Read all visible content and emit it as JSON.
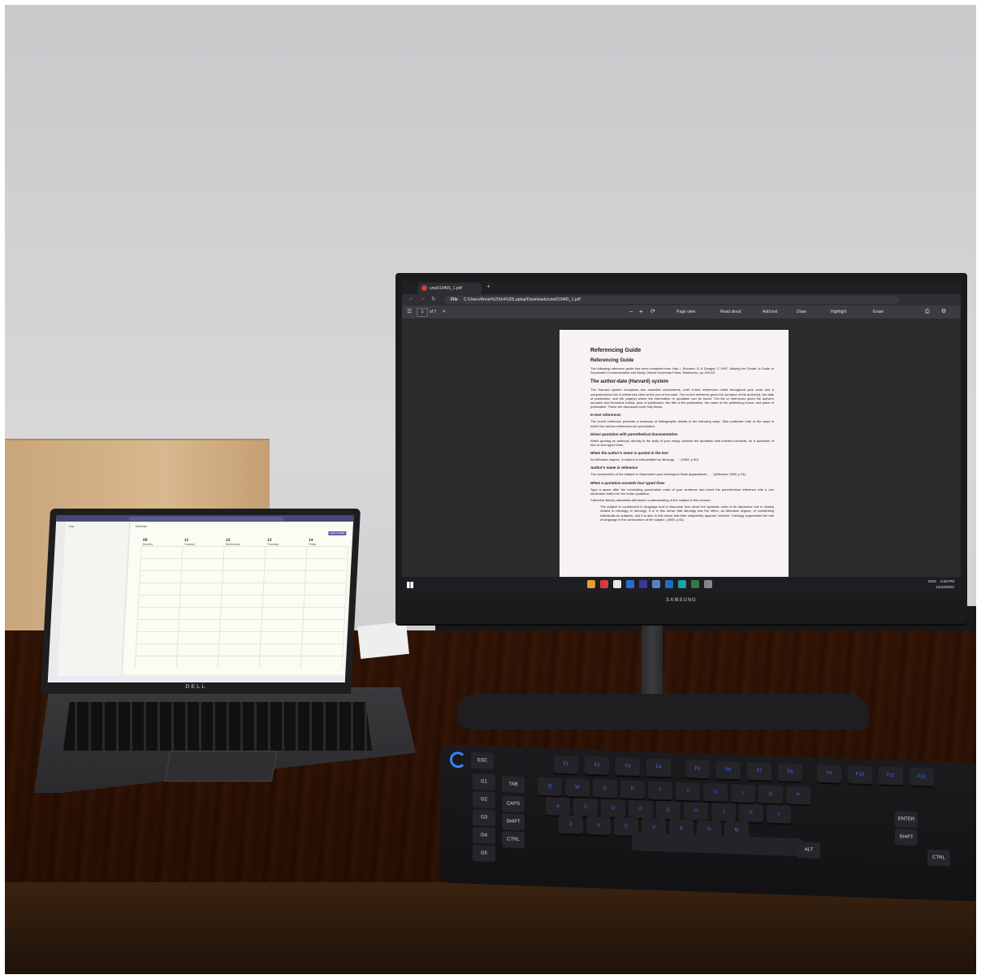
{
  "monitor": {
    "tab_title": "unw019465_1.pdf",
    "address_scheme": "File",
    "address_path": "C:/Users/Annie%20Uni%20Laptop/Downloads/unw019465_1.pdf",
    "page_number": "1",
    "page_count": "of 7",
    "toolbar": {
      "page_view": "Page view",
      "read_aloud": "Read aloud",
      "add_text": "Add text",
      "draw": "Draw",
      "highlight": "Highlight",
      "erase": "Erase"
    },
    "brand": "SAMSUNG",
    "tray_time": "5:46 PM",
    "tray_date": "12/10/2022",
    "tray_lang": "ENG"
  },
  "document": {
    "title": "Referencing Guide",
    "subtitle": "Referencing Guide",
    "intro": "The following reference guide has been extracted from Hay, I, Bochner, D & Dungey, C 1997, Making the Grade: A Guide to Successful Communication and Study, Oxford University Press, Melbourne, pp 139-45.",
    "section1_title": "The author-date (Harvard) system",
    "section1_body": "The Harvard system comprises two essential components, brief in-text references noted throughout your work and a comprehensive list of references cited at the end of the work. The in-text reference gives the surname of the author(s), the date of publication, and the page(s) where the information or quotation can be found. The list of references gives the author's surname and forename initials, year of publication, the title of the publication, the name of the publishing house, and place of publication. These are discussed more fully below.",
    "section2_title": "In-text references",
    "section2_body": "The in-text reference presents a summary of bibliographic details in the following ways. Take particular note of the ways in which the various references are punctuated.",
    "sub1_title": "Direct quotation with parenthetical documentation",
    "sub1_body": "When quoting an author(s) directly in the body of your essay, enclose the quotation with inverted commas, for a quotation of four or less typed lines.",
    "sub2_title": "When the author's name is quoted in the text",
    "sub2_body": "As Althusser argues, 'a subject is interpellated by ideology . . .' (1969, p 50).",
    "sub3_title": "Author's name in reference",
    "sub3_body": "The construction of the subject is 'dependent upon Ideological State Apparatuses . . .' (Althusser 1969, p 51).",
    "sub4_title": "When a quotation exceeds four typed lines",
    "sub4_body": "Type a space after the concluding punctuation mark of your sentence and insert the parenthetical reference with a one centimetre indent for the entire quotation.",
    "sub4_body2": "Catherine Belsey articulates Althusser's understanding of the subject in this manner:",
    "blockquote": "The subject is constructed in language and in discourse and, since the symbolic order is its discursive role is closely related to ideology, in ideology. It is in this sense that ideology has the effect, as Althusser argues, of constituting individuals as subjects, and it is also in this sense that their subjectivity appears 'obvious'. Ideology suppresses the role of language in the construction of the subject. (1980, p 61)"
  },
  "laptop": {
    "brand": "DELL",
    "app_title": "Calendar",
    "left_title": "Chat",
    "days": [
      {
        "num": "09",
        "name": "Monday"
      },
      {
        "num": "11",
        "name": "Tuesday"
      },
      {
        "num": "12",
        "name": "Wednesday"
      },
      {
        "num": "13",
        "name": "Thursday"
      },
      {
        "num": "14",
        "name": "Friday"
      }
    ],
    "new_meeting": "New meeting"
  },
  "keyboard": {
    "g_keys": [
      "G1",
      "G2",
      "G3",
      "G4",
      "G5"
    ],
    "row_mod": [
      "ESC",
      "TAB",
      "CAPS",
      "SHIFT",
      "CTRL"
    ],
    "letters_row1": [
      "Q",
      "W",
      "E",
      "R",
      "T",
      "Y",
      "U",
      "I",
      "O",
      "P"
    ],
    "letters_row2": [
      "A",
      "S",
      "D",
      "F",
      "G",
      "H",
      "J",
      "K",
      "L"
    ],
    "letters_row3": [
      "Z",
      "X",
      "C",
      "V",
      "B",
      "N",
      "M"
    ],
    "fkeys": [
      "F1",
      "F2",
      "F3",
      "F4",
      "F5",
      "F6",
      "F7",
      "F8",
      "F9",
      "F10",
      "F11",
      "F12"
    ],
    "right_mods": [
      "ALT",
      "ENTER",
      "SHIFT",
      "CTRL"
    ],
    "accent": "#3a6bff"
  }
}
